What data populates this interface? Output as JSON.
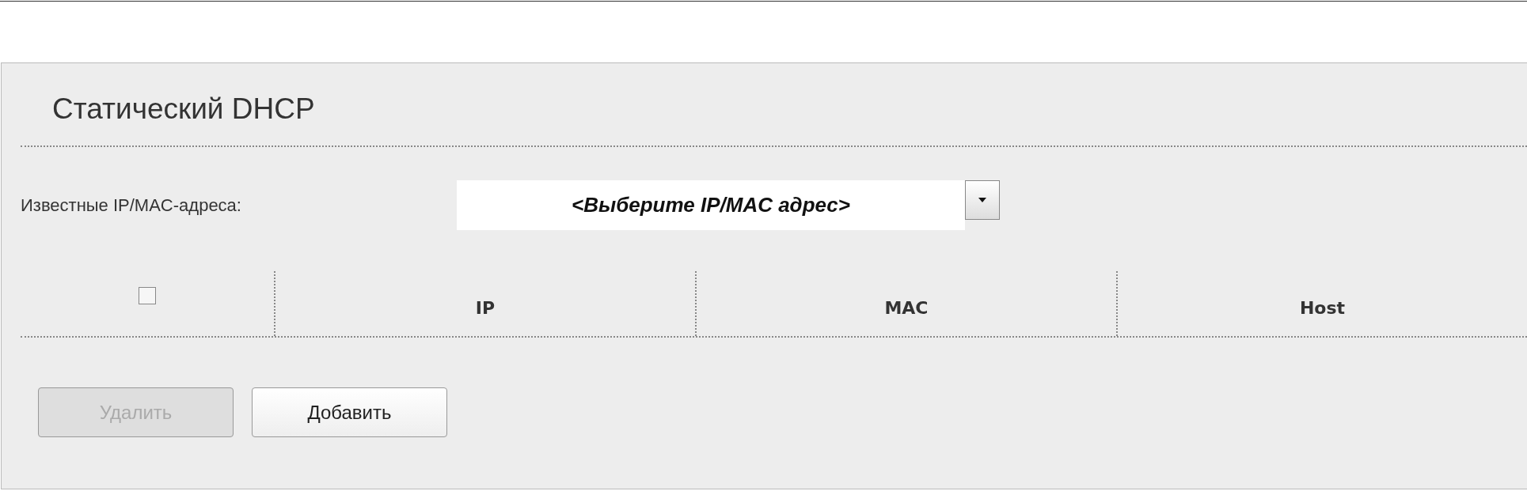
{
  "title": "Статический DHCP",
  "known_addresses": {
    "label": "Известные IP/MAC-адреса:",
    "value": "<Выберите IP/MAC адрес>"
  },
  "table": {
    "select_all": {
      "checked": false
    },
    "columns": [
      "IP",
      "MAC",
      "Host"
    ]
  },
  "buttons": [
    {
      "label": "Удалить",
      "disabled": true
    },
    {
      "label": "Добавить",
      "disabled": false
    }
  ]
}
